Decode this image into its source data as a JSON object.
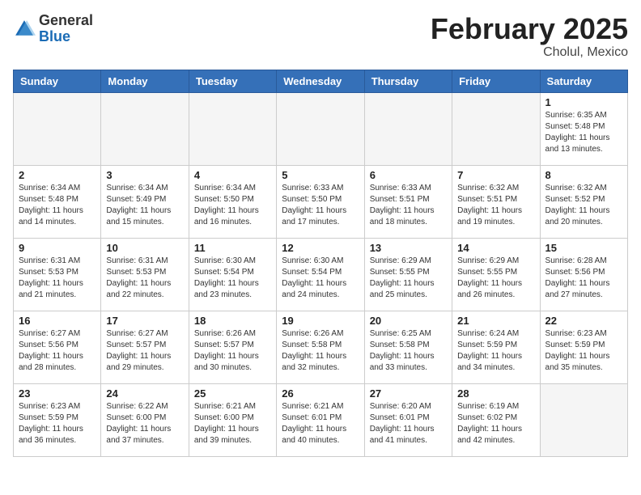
{
  "header": {
    "logo_line1": "General",
    "logo_line2": "Blue",
    "month_year": "February 2025",
    "location": "Cholul, Mexico"
  },
  "weekdays": [
    "Sunday",
    "Monday",
    "Tuesday",
    "Wednesday",
    "Thursday",
    "Friday",
    "Saturday"
  ],
  "weeks": [
    [
      {
        "day": "",
        "info": ""
      },
      {
        "day": "",
        "info": ""
      },
      {
        "day": "",
        "info": ""
      },
      {
        "day": "",
        "info": ""
      },
      {
        "day": "",
        "info": ""
      },
      {
        "day": "",
        "info": ""
      },
      {
        "day": "1",
        "info": "Sunrise: 6:35 AM\nSunset: 5:48 PM\nDaylight: 11 hours\nand 13 minutes."
      }
    ],
    [
      {
        "day": "2",
        "info": "Sunrise: 6:34 AM\nSunset: 5:48 PM\nDaylight: 11 hours\nand 14 minutes."
      },
      {
        "day": "3",
        "info": "Sunrise: 6:34 AM\nSunset: 5:49 PM\nDaylight: 11 hours\nand 15 minutes."
      },
      {
        "day": "4",
        "info": "Sunrise: 6:34 AM\nSunset: 5:50 PM\nDaylight: 11 hours\nand 16 minutes."
      },
      {
        "day": "5",
        "info": "Sunrise: 6:33 AM\nSunset: 5:50 PM\nDaylight: 11 hours\nand 17 minutes."
      },
      {
        "day": "6",
        "info": "Sunrise: 6:33 AM\nSunset: 5:51 PM\nDaylight: 11 hours\nand 18 minutes."
      },
      {
        "day": "7",
        "info": "Sunrise: 6:32 AM\nSunset: 5:51 PM\nDaylight: 11 hours\nand 19 minutes."
      },
      {
        "day": "8",
        "info": "Sunrise: 6:32 AM\nSunset: 5:52 PM\nDaylight: 11 hours\nand 20 minutes."
      }
    ],
    [
      {
        "day": "9",
        "info": "Sunrise: 6:31 AM\nSunset: 5:53 PM\nDaylight: 11 hours\nand 21 minutes."
      },
      {
        "day": "10",
        "info": "Sunrise: 6:31 AM\nSunset: 5:53 PM\nDaylight: 11 hours\nand 22 minutes."
      },
      {
        "day": "11",
        "info": "Sunrise: 6:30 AM\nSunset: 5:54 PM\nDaylight: 11 hours\nand 23 minutes."
      },
      {
        "day": "12",
        "info": "Sunrise: 6:30 AM\nSunset: 5:54 PM\nDaylight: 11 hours\nand 24 minutes."
      },
      {
        "day": "13",
        "info": "Sunrise: 6:29 AM\nSunset: 5:55 PM\nDaylight: 11 hours\nand 25 minutes."
      },
      {
        "day": "14",
        "info": "Sunrise: 6:29 AM\nSunset: 5:55 PM\nDaylight: 11 hours\nand 26 minutes."
      },
      {
        "day": "15",
        "info": "Sunrise: 6:28 AM\nSunset: 5:56 PM\nDaylight: 11 hours\nand 27 minutes."
      }
    ],
    [
      {
        "day": "16",
        "info": "Sunrise: 6:27 AM\nSunset: 5:56 PM\nDaylight: 11 hours\nand 28 minutes."
      },
      {
        "day": "17",
        "info": "Sunrise: 6:27 AM\nSunset: 5:57 PM\nDaylight: 11 hours\nand 29 minutes."
      },
      {
        "day": "18",
        "info": "Sunrise: 6:26 AM\nSunset: 5:57 PM\nDaylight: 11 hours\nand 30 minutes."
      },
      {
        "day": "19",
        "info": "Sunrise: 6:26 AM\nSunset: 5:58 PM\nDaylight: 11 hours\nand 32 minutes."
      },
      {
        "day": "20",
        "info": "Sunrise: 6:25 AM\nSunset: 5:58 PM\nDaylight: 11 hours\nand 33 minutes."
      },
      {
        "day": "21",
        "info": "Sunrise: 6:24 AM\nSunset: 5:59 PM\nDaylight: 11 hours\nand 34 minutes."
      },
      {
        "day": "22",
        "info": "Sunrise: 6:23 AM\nSunset: 5:59 PM\nDaylight: 11 hours\nand 35 minutes."
      }
    ],
    [
      {
        "day": "23",
        "info": "Sunrise: 6:23 AM\nSunset: 5:59 PM\nDaylight: 11 hours\nand 36 minutes."
      },
      {
        "day": "24",
        "info": "Sunrise: 6:22 AM\nSunset: 6:00 PM\nDaylight: 11 hours\nand 37 minutes."
      },
      {
        "day": "25",
        "info": "Sunrise: 6:21 AM\nSunset: 6:00 PM\nDaylight: 11 hours\nand 39 minutes."
      },
      {
        "day": "26",
        "info": "Sunrise: 6:21 AM\nSunset: 6:01 PM\nDaylight: 11 hours\nand 40 minutes."
      },
      {
        "day": "27",
        "info": "Sunrise: 6:20 AM\nSunset: 6:01 PM\nDaylight: 11 hours\nand 41 minutes."
      },
      {
        "day": "28",
        "info": "Sunrise: 6:19 AM\nSunset: 6:02 PM\nDaylight: 11 hours\nand 42 minutes."
      },
      {
        "day": "",
        "info": ""
      }
    ]
  ]
}
